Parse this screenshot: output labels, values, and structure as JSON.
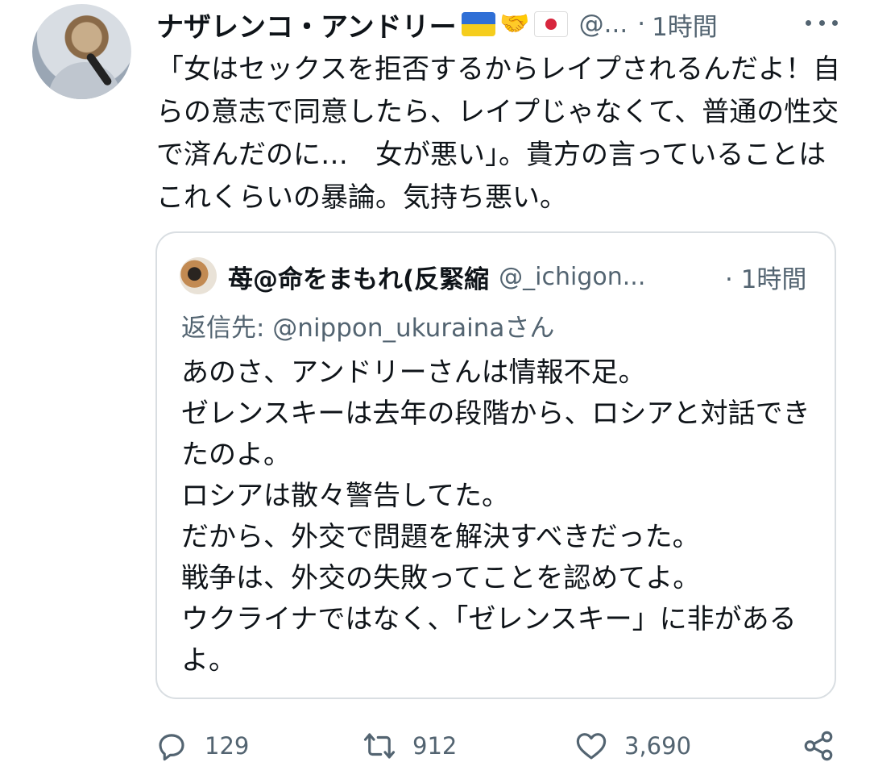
{
  "tweet": {
    "author_name": "ナザレンコ・アンドリー",
    "handle": "@...",
    "separator": "·",
    "time": "1時間",
    "text": "「女はセックスを拒否するからレイプされるんだよ！自らの意志で同意したら、レイプじゃなくて、普通の性交で済んだのに…　女が悪い」。貴方の言っていることはこれくらいの暴論。気持ち悪い。",
    "emojis": [
      "ukraine-flag",
      "handshake",
      "japan-flag"
    ]
  },
  "quoted_tweet": {
    "author_name": "苺@命をまもれ(反緊縮",
    "handle": "@_ichigon...",
    "time": "· 1時間",
    "reply_to": "返信先: @nippon_ukurainaさん",
    "text": "あのさ、アンドリーさんは情報不足。\nゼレンスキーは去年の段階から、ロシアと対話できたのよ。\nロシアは散々警告してた。\nだから、外交で問題を解決すべきだった。\n戦争は、外交の失敗ってことを認めてよ。\nウクライナではなく、「ゼレンスキー」に非があるよ。"
  },
  "actions": {
    "reply_count": "129",
    "retweet_count": "912",
    "like_count": "3,690"
  },
  "colors": {
    "text": "#0f1419",
    "secondary": "#536471",
    "border": "#d9dee2"
  }
}
